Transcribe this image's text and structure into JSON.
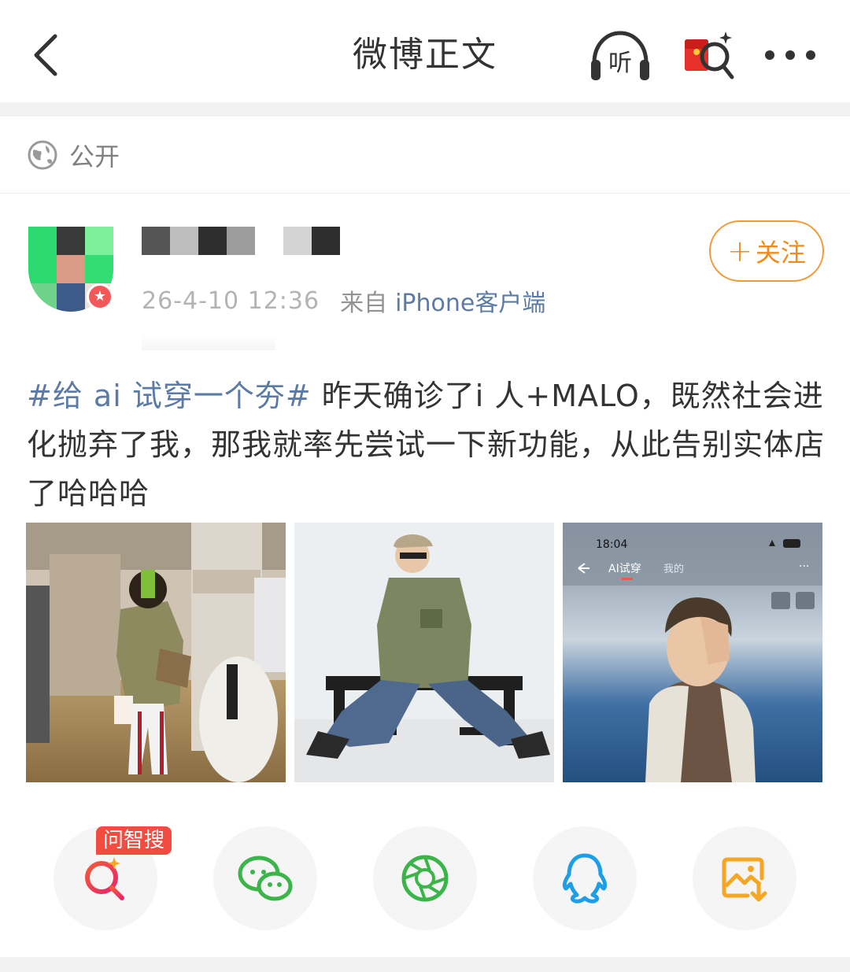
{
  "nav": {
    "title": "微博正文",
    "back_icon": "chevron-left-icon",
    "listen_label": "听",
    "listen_icon": "headphones-icon",
    "redpacket_icon": "red-packet-search-icon",
    "more_icon": "more-dots-icon"
  },
  "visibility": {
    "icon": "globe-icon",
    "label": "公开"
  },
  "author": {
    "badge": "★",
    "time": "26-4-10 12:36",
    "from_label": "来自",
    "source": "iPhone客户端"
  },
  "follow": {
    "plus": "+",
    "label": "关注"
  },
  "post": {
    "hashtag": "#给 ai 试穿一个夯#",
    "text": " 昨天确诊了i 人+MALO，既然社会进化抛弃了我，那我就率先尝试一下新功能，从此告别实体店了哈哈哈"
  },
  "images": {
    "img3_time": "18:04",
    "img3_title": "AI试穿",
    "img3_tab": "我的",
    "img3_more": "···"
  },
  "share": {
    "ai_search_tag": "问智搜",
    "items": [
      "ai-search-icon",
      "wechat-icon",
      "moments-icon",
      "qq-icon",
      "save-image-icon"
    ]
  },
  "colors": {
    "accent_orange": "#f08c1d",
    "link_blue": "#5b7ba6",
    "red_tag": "#f14c3f"
  }
}
